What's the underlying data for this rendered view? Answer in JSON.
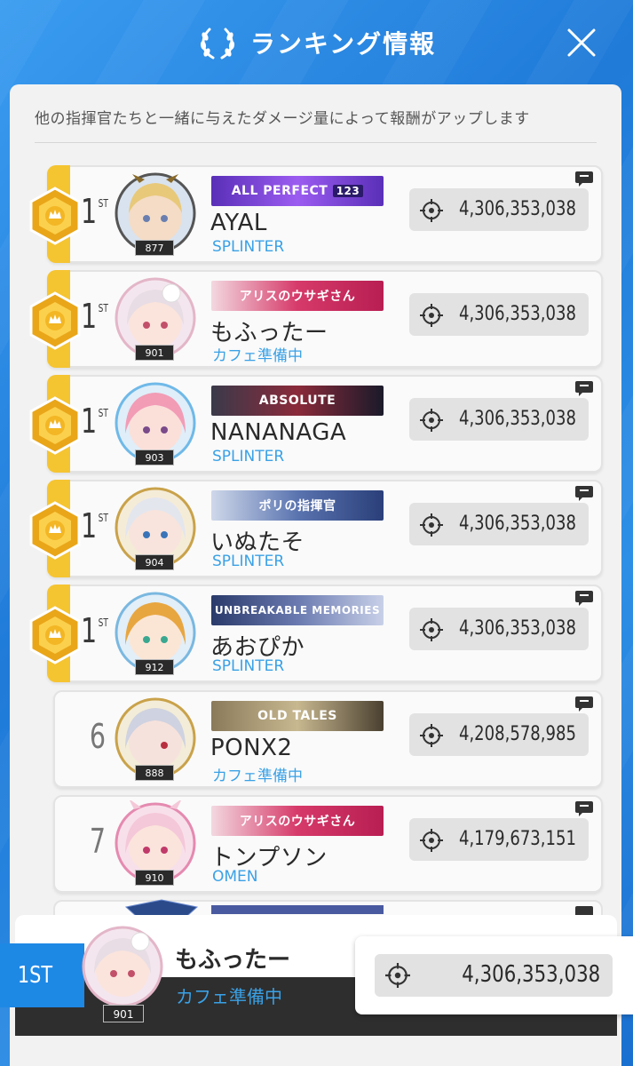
{
  "header": {
    "title": "ランキング情報"
  },
  "subtitle": "他の指揮官たちと一緒に与えたダメージ量によって報酬がアップします",
  "entries": [
    {
      "rank": "1",
      "rank_suffix": "ST",
      "level": "877",
      "banner": "ALL PERFECT",
      "banner_sub": "123",
      "name": "AYAL",
      "guild": "SPLINTER",
      "score": "4,306,353,038"
    },
    {
      "rank": "1",
      "rank_suffix": "ST",
      "level": "901",
      "banner": "アリスのウサギさん",
      "name": "もふったー",
      "guild": "カフェ準備中",
      "score": "4,306,353,038"
    },
    {
      "rank": "1",
      "rank_suffix": "ST",
      "level": "903",
      "banner": "ABSOLUTE",
      "name": "NANANAGA",
      "guild": "SPLINTER",
      "score": "4,306,353,038"
    },
    {
      "rank": "1",
      "rank_suffix": "ST",
      "level": "904",
      "banner": "ポリの指揮官",
      "name": "いぬたそ",
      "guild": "SPLINTER",
      "score": "4,306,353,038"
    },
    {
      "rank": "1",
      "rank_suffix": "ST",
      "level": "912",
      "banner": "UNBREAKABLE MEMORIES",
      "name": "あおぴか",
      "guild": "SPLINTER",
      "score": "4,306,353,038"
    },
    {
      "rank": "6",
      "level": "888",
      "banner": "OLD TALES",
      "name": "PONX2",
      "guild": "カフェ準備中",
      "score": "4,208,578,985"
    },
    {
      "rank": "7",
      "level": "910",
      "banner": "アリスのウサギさん",
      "name": "トンプソン",
      "guild": "OMEN",
      "score": "4,179,673,151"
    }
  ],
  "my_rank": {
    "rank": "1ST",
    "level": "901",
    "name": "もふったー",
    "guild": "カフェ準備中",
    "score": "4,306,353,038"
  },
  "colors": {
    "accent": "#1e88e5",
    "gold": "#f5c431",
    "guild_text": "#3aa1e6"
  }
}
